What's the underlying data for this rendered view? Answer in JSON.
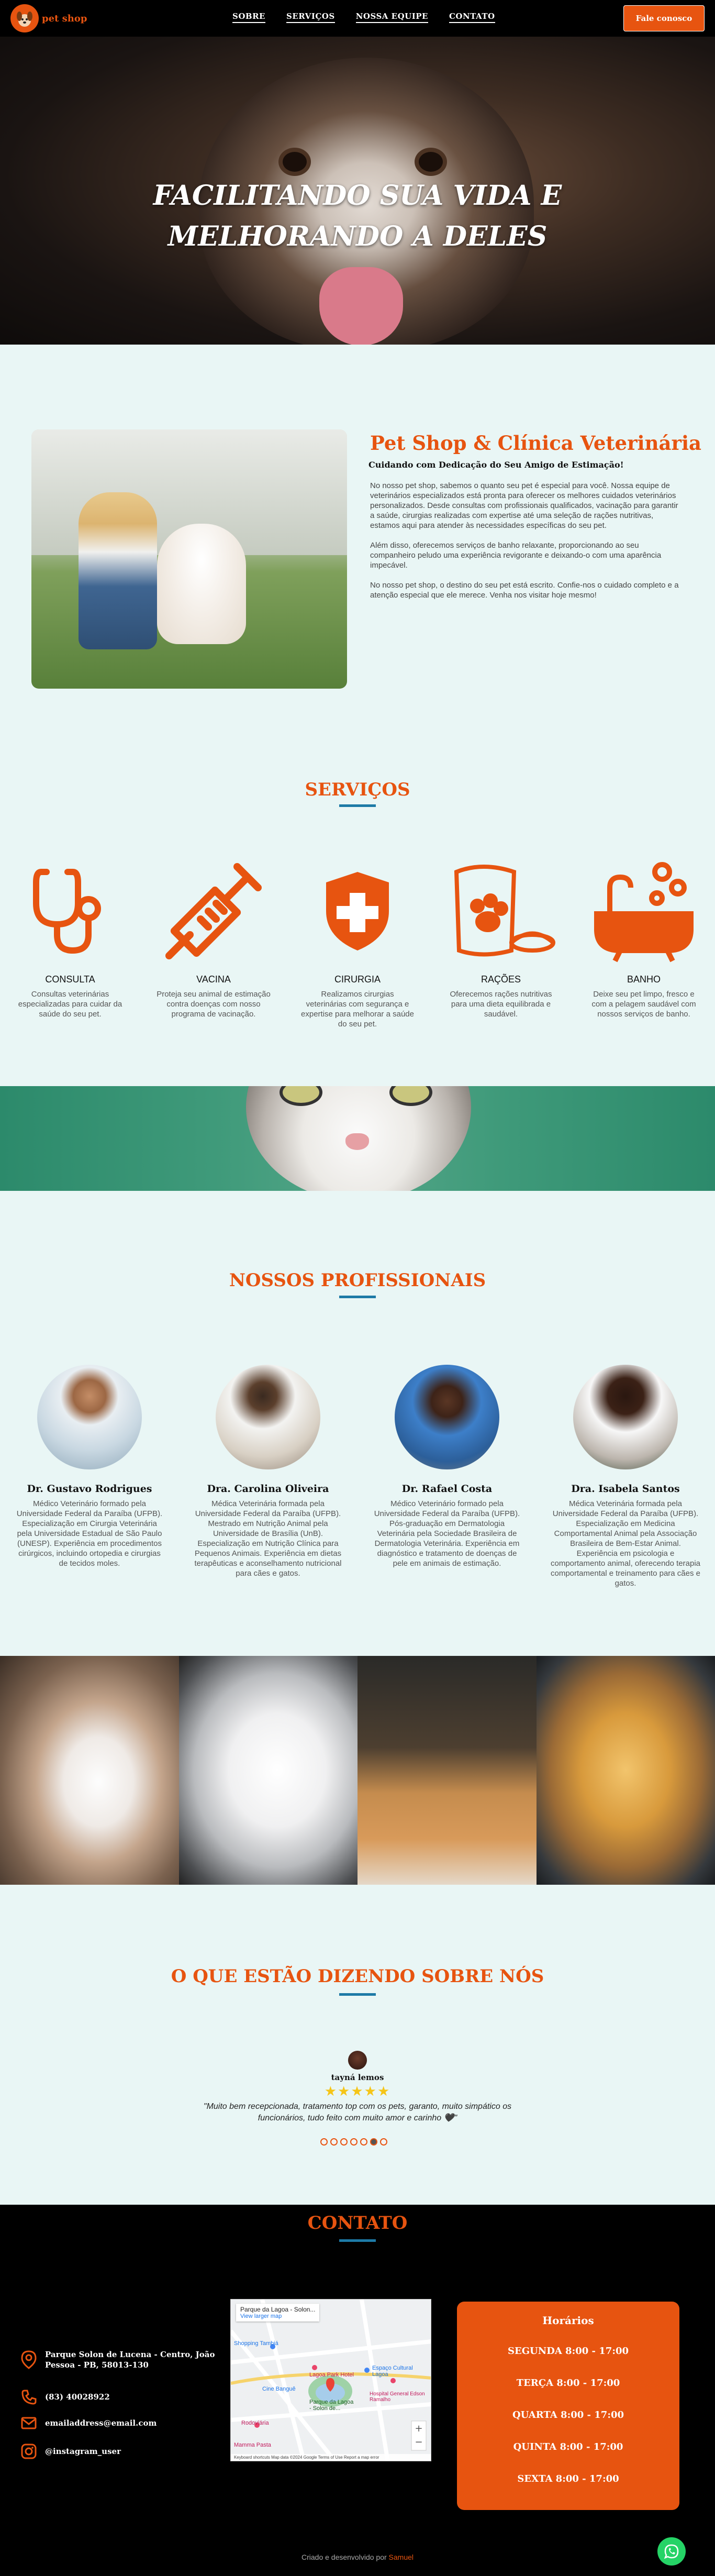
{
  "nav": {
    "logo_text": "pet shop",
    "items": [
      {
        "label": "SOBRE"
      },
      {
        "label": "SERVIÇOS"
      },
      {
        "label": "NOSSA EQUIPE"
      },
      {
        "label": "CONTATO"
      }
    ],
    "cta_label": "Fale conosco"
  },
  "hero": {
    "line1": "FACILITANDO SUA VIDA E",
    "line2": "MELHORANDO A DELES"
  },
  "about": {
    "title": "Pet Shop & Clínica Veterinária",
    "subtitle": "Cuidando com Dedicação do Seu Amigo de Estimação!",
    "p1": "No nosso pet shop, sabemos o quanto seu pet é especial para você. Nossa equipe de veterinários especializados está pronta para oferecer os melhores cuidados veterinários personalizados. Desde consultas com profissionais qualificados, vacinação para garantir a saúde, cirurgias realizadas com expertise até uma seleção de rações nutritivas, estamos aqui para atender às necessidades específicas do seu pet.",
    "p2": "Além disso, oferecemos serviços de banho relaxante, proporcionando ao seu companheiro peludo uma experiência revigorante e deixando-o com uma aparência impecável.",
    "p3": "No nosso pet shop, o destino do seu pet está escrito. Confie-nos o cuidado completo e a atenção especial que ele merece. Venha nos visitar hoje mesmo!"
  },
  "services": {
    "title": "SERVIÇOS",
    "items": [
      {
        "icon": "stethoscope-icon",
        "name": "CONSULTA",
        "desc": "Consultas veterinárias especializadas para cuidar da saúde do seu pet."
      },
      {
        "icon": "syringe-icon",
        "name": "VACINA",
        "desc": "Proteja seu animal de estimação contra doenças com nosso programa de vacinação."
      },
      {
        "icon": "medical-shield-icon",
        "name": "CIRURGIA",
        "desc": "Realizamos cirurgias veterinárias com segurança e expertise para melhorar a saúde do seu pet."
      },
      {
        "icon": "pet-food-icon",
        "name": "RAÇÕES",
        "desc": "Oferecemos rações nutritivas para uma dieta equilibrada e saudável."
      },
      {
        "icon": "bathtub-icon",
        "name": "BANHO",
        "desc": "Deixe seu pet limpo, fresco e com a pelagem saudável com nossos serviços de banho."
      }
    ]
  },
  "team": {
    "title": "NOSSOS PROFISSIONAIS",
    "members": [
      {
        "name": "Dr. Gustavo Rodrigues",
        "bio": "Médico Veterinário formado pela Universidade Federal da Paraíba (UFPB). Especialização em Cirurgia Veterinária pela Universidade Estadual de São Paulo (UNESP). Experiência em procedimentos cirúrgicos, incluindo ortopedia e cirurgias de tecidos moles."
      },
      {
        "name": "Dra. Carolina Oliveira",
        "bio": "Médica Veterinária formada pela Universidade Federal da Paraíba (UFPB). Mestrado em Nutrição Animal pela Universidade de Brasília (UnB). Especialização em Nutrição Clínica para Pequenos Animais. Experiência em dietas terapêuticas e aconselhamento nutricional para cães e gatos."
      },
      {
        "name": "Dr. Rafael Costa",
        "bio": "Médico Veterinário formado pela Universidade Federal da Paraíba (UFPB). Pós-graduação em Dermatologia Veterinária pela Sociedade Brasileira de Dermatologia Veterinária. Experiência em diagnóstico e tratamento de doenças de pele em animais de estimação."
      },
      {
        "name": "Dra. Isabela Santos",
        "bio": "Médica Veterinária formada pela Universidade Federal da Paraíba (UFPB). Especialização em Medicina Comportamental Animal pela Associação Brasileira de Bem-Estar Animal. Experiência em psicologia e comportamento animal, oferecendo terapia comportamental e treinamento para cães e gatos."
      }
    ]
  },
  "testimonials": {
    "title": "O QUE ESTÃO DIZENDO SOBRE NÓS",
    "name": "tayná lemos",
    "stars": "★★★★★",
    "quote": "\"Muito bem recepcionada, tratamento top com os pets, garanto, muito simpático os funcionários, tudo feito com muito amor e carinho 🖤\""
  },
  "contact": {
    "title": "CONTATO",
    "address": "Parque Solon de Lucena - Centro, João Pessoa - PB, 58013-130",
    "phone": "(83) 40028922",
    "email": "emailaddress@email.com",
    "instagram": "@instagram_user",
    "map": {
      "place_name": "Parque da Lagoa - Solon...",
      "view_larger": "View larger map",
      "labels": {
        "shopping": "Shopping Tambiá",
        "hotel": "Lagoa Park Hotel",
        "park": "Parque da Lagoa - Solon de...",
        "cinema": "Cine Banguê",
        "rodoviaria": "Rodoviária",
        "lagoa": "Espaço Cultural Lagoa",
        "hospital": "Hospital General Edson Ramalho",
        "mamma": "Mamma Pasta"
      },
      "footer": "Keyboard shortcuts   Map data ©2024 Google   Terms of Use   Report a map error"
    },
    "hours_title": "Horários",
    "hours": [
      "SEGUNDA 8:00 - 17:00",
      "TERÇA 8:00 - 17:00",
      "QUARTA 8:00 - 17:00",
      "QUINTA 8:00 - 17:00",
      "SEXTA 8:00 - 17:00"
    ],
    "credit_prefix": "Criado e desenvolvido por",
    "credit_author": "Samuel"
  },
  "colors": {
    "accent": "#e75410",
    "blue": "#1d7aa6",
    "bg": "#e9f6f5"
  }
}
